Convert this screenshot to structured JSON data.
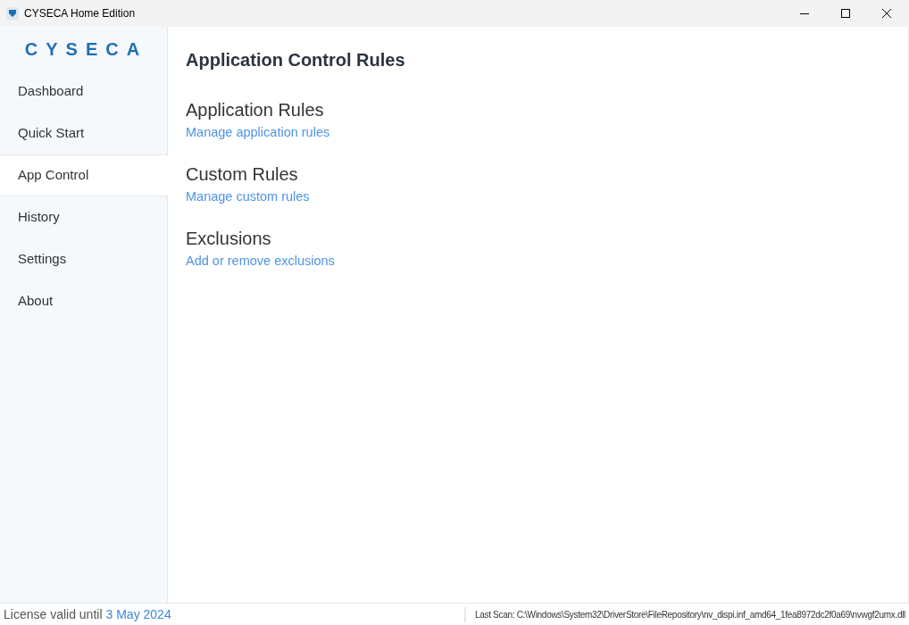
{
  "window": {
    "title": "CYSECA Home Edition"
  },
  "sidebar": {
    "logo": "CYSECA",
    "items": [
      {
        "label": "Dashboard",
        "selected": false
      },
      {
        "label": "Quick Start",
        "selected": false
      },
      {
        "label": "App Control",
        "selected": true
      },
      {
        "label": "History",
        "selected": false
      },
      {
        "label": "Settings",
        "selected": false
      },
      {
        "label": "About",
        "selected": false
      }
    ]
  },
  "page": {
    "title": "Application Control Rules",
    "sections": [
      {
        "heading": "Application Rules",
        "link": "Manage application rules"
      },
      {
        "heading": "Custom Rules",
        "link": "Manage custom rules"
      },
      {
        "heading": "Exclusions",
        "link": "Add or remove exclusions"
      }
    ]
  },
  "status_bar": {
    "license_label": "License valid until",
    "license_date": "3 May 2024",
    "last_scan": "Last Scan: C:\\Windows\\System32\\DriverStore\\FileRepository\\nv_dispi.inf_amd64_1fea8972dc2f0a69\\nvwgf2umx.dll"
  }
}
